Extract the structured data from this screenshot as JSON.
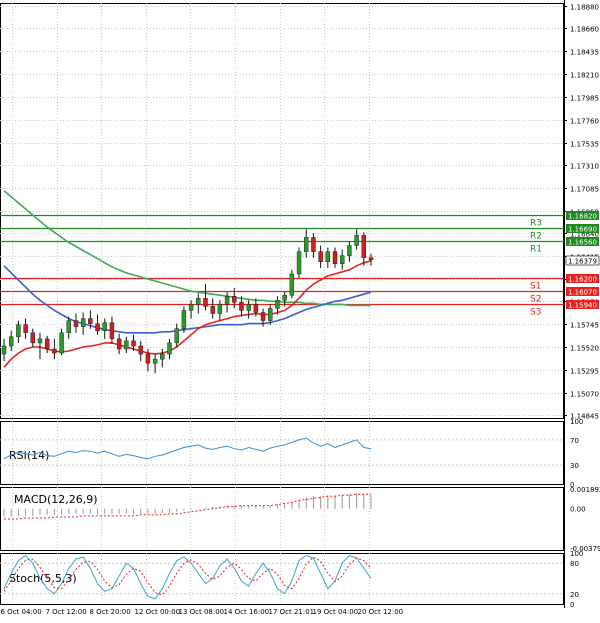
{
  "chart_data": {
    "type": "candlestick",
    "main_panel": {
      "y_ticks": [
        "1.18880",
        "1.18660",
        "1.18435",
        "1.18210",
        "1.17985",
        "1.17760",
        "1.17535",
        "1.17310",
        "1.17085",
        "1.16860",
        "1.16640",
        "1.16415",
        "1.16190",
        "1.15970",
        "1.15745",
        "1.15520",
        "1.15295",
        "1.15070",
        "1.14845"
      ],
      "ylim": [
        1.1482,
        1.1891
      ],
      "current_price": "1.16379",
      "levels": [
        {
          "label": "R3",
          "value": 1.1682,
          "value_label": "1.16820",
          "color": "#1f8a1f"
        },
        {
          "label": "R2",
          "value": 1.1669,
          "value_label": "1.16690",
          "color": "#1f8a1f"
        },
        {
          "label": "R1",
          "value": 1.1656,
          "value_label": "1.16560",
          "color": "#1f8a1f"
        },
        {
          "label": "S1",
          "value": 1.162,
          "value_label": "1.16200",
          "color": "#e52222"
        },
        {
          "label": "S2",
          "value": 1.1607,
          "value_label": "1.16070",
          "color": "#e52222"
        },
        {
          "label": "S3",
          "value": 1.1594,
          "value_label": "1.15940",
          "color": "#e52222"
        }
      ],
      "candles": [
        {
          "o": 1.1545,
          "h": 1.156,
          "l": 1.1538,
          "c": 1.1553
        },
        {
          "o": 1.1553,
          "h": 1.1568,
          "l": 1.1548,
          "c": 1.1562
        },
        {
          "o": 1.1562,
          "h": 1.1578,
          "l": 1.1556,
          "c": 1.1574
        },
        {
          "o": 1.1574,
          "h": 1.158,
          "l": 1.156,
          "c": 1.1566
        },
        {
          "o": 1.1566,
          "h": 1.157,
          "l": 1.1552,
          "c": 1.1556
        },
        {
          "o": 1.1556,
          "h": 1.1566,
          "l": 1.154,
          "c": 1.156
        },
        {
          "o": 1.156,
          "h": 1.1563,
          "l": 1.1546,
          "c": 1.155
        },
        {
          "o": 1.155,
          "h": 1.156,
          "l": 1.154,
          "c": 1.1546
        },
        {
          "o": 1.1546,
          "h": 1.157,
          "l": 1.1544,
          "c": 1.1566
        },
        {
          "o": 1.1566,
          "h": 1.1582,
          "l": 1.156,
          "c": 1.1578
        },
        {
          "o": 1.1578,
          "h": 1.1585,
          "l": 1.1566,
          "c": 1.1572
        },
        {
          "o": 1.1572,
          "h": 1.1586,
          "l": 1.1564,
          "c": 1.158
        },
        {
          "o": 1.158,
          "h": 1.1588,
          "l": 1.157,
          "c": 1.1575
        },
        {
          "o": 1.1575,
          "h": 1.1584,
          "l": 1.1564,
          "c": 1.1568
        },
        {
          "o": 1.1568,
          "h": 1.158,
          "l": 1.156,
          "c": 1.1576
        },
        {
          "o": 1.1576,
          "h": 1.1582,
          "l": 1.1555,
          "c": 1.156
        },
        {
          "o": 1.156,
          "h": 1.1565,
          "l": 1.1545,
          "c": 1.155
        },
        {
          "o": 1.155,
          "h": 1.1562,
          "l": 1.1546,
          "c": 1.1558
        },
        {
          "o": 1.1558,
          "h": 1.1564,
          "l": 1.1548,
          "c": 1.1553
        },
        {
          "o": 1.1553,
          "h": 1.1558,
          "l": 1.1538,
          "c": 1.1545
        },
        {
          "o": 1.1545,
          "h": 1.155,
          "l": 1.1528,
          "c": 1.1536
        },
        {
          "o": 1.1536,
          "h": 1.1545,
          "l": 1.1526,
          "c": 1.154
        },
        {
          "o": 1.154,
          "h": 1.155,
          "l": 1.1532,
          "c": 1.1545
        },
        {
          "o": 1.1545,
          "h": 1.156,
          "l": 1.154,
          "c": 1.1556
        },
        {
          "o": 1.1556,
          "h": 1.1575,
          "l": 1.1552,
          "c": 1.157
        },
        {
          "o": 1.157,
          "h": 1.1592,
          "l": 1.1566,
          "c": 1.1588
        },
        {
          "o": 1.1588,
          "h": 1.1598,
          "l": 1.158,
          "c": 1.1594
        },
        {
          "o": 1.1594,
          "h": 1.1605,
          "l": 1.1585,
          "c": 1.16
        },
        {
          "o": 1.16,
          "h": 1.1614,
          "l": 1.1588,
          "c": 1.1592
        },
        {
          "o": 1.1592,
          "h": 1.16,
          "l": 1.158,
          "c": 1.1585
        },
        {
          "o": 1.1585,
          "h": 1.1598,
          "l": 1.1578,
          "c": 1.1594
        },
        {
          "o": 1.1594,
          "h": 1.1606,
          "l": 1.1586,
          "c": 1.1602
        },
        {
          "o": 1.1602,
          "h": 1.161,
          "l": 1.159,
          "c": 1.1596
        },
        {
          "o": 1.1596,
          "h": 1.1602,
          "l": 1.1582,
          "c": 1.1588
        },
        {
          "o": 1.1588,
          "h": 1.1598,
          "l": 1.158,
          "c": 1.1594
        },
        {
          "o": 1.1594,
          "h": 1.16,
          "l": 1.1582,
          "c": 1.1586
        },
        {
          "o": 1.1586,
          "h": 1.159,
          "l": 1.1572,
          "c": 1.1578
        },
        {
          "o": 1.1578,
          "h": 1.1594,
          "l": 1.1574,
          "c": 1.159
        },
        {
          "o": 1.159,
          "h": 1.1602,
          "l": 1.1584,
          "c": 1.1598
        },
        {
          "o": 1.1598,
          "h": 1.1606,
          "l": 1.1592,
          "c": 1.1603
        },
        {
          "o": 1.1603,
          "h": 1.1628,
          "l": 1.16,
          "c": 1.1624
        },
        {
          "o": 1.1624,
          "h": 1.165,
          "l": 1.162,
          "c": 1.1646
        },
        {
          "o": 1.1646,
          "h": 1.1668,
          "l": 1.164,
          "c": 1.166
        },
        {
          "o": 1.166,
          "h": 1.1664,
          "l": 1.164,
          "c": 1.1646
        },
        {
          "o": 1.1646,
          "h": 1.1652,
          "l": 1.163,
          "c": 1.1636
        },
        {
          "o": 1.1636,
          "h": 1.165,
          "l": 1.163,
          "c": 1.1646
        },
        {
          "o": 1.1646,
          "h": 1.165,
          "l": 1.163,
          "c": 1.1634
        },
        {
          "o": 1.1634,
          "h": 1.1648,
          "l": 1.1628,
          "c": 1.1642
        },
        {
          "o": 1.1642,
          "h": 1.1656,
          "l": 1.1636,
          "c": 1.1652
        },
        {
          "o": 1.1652,
          "h": 1.1668,
          "l": 1.1648,
          "c": 1.1662
        },
        {
          "o": 1.1662,
          "h": 1.1665,
          "l": 1.1632,
          "c": 1.164
        },
        {
          "o": 1.164,
          "h": 1.1644,
          "l": 1.1632,
          "c": 1.1638
        }
      ],
      "ma_red": [
        1.1532,
        1.154,
        1.1546,
        1.155,
        1.1552,
        1.1552,
        1.155,
        1.1548,
        1.1547,
        1.1548,
        1.155,
        1.1552,
        1.1553,
        1.1554,
        1.1556,
        1.1556,
        1.1554,
        1.1552,
        1.155,
        1.1548,
        1.1546,
        1.1545,
        1.1546,
        1.1548,
        1.1552,
        1.1558,
        1.1564,
        1.157,
        1.1574,
        1.1576,
        1.1578,
        1.158,
        1.1582,
        1.1583,
        1.1584,
        1.1585,
        1.1584,
        1.1584,
        1.1586,
        1.1588,
        1.1593,
        1.16,
        1.1608,
        1.1614,
        1.1618,
        1.1622,
        1.1624,
        1.1626,
        1.1628,
        1.1632,
        1.1635,
        1.1637
      ],
      "ma_blue": [
        1.1632,
        1.1625,
        1.1618,
        1.1611,
        1.1604,
        1.1598,
        1.1593,
        1.1588,
        1.1584,
        1.158,
        1.1577,
        1.1575,
        1.1573,
        1.1571,
        1.1569,
        1.1568,
        1.1567,
        1.1566,
        1.1566,
        1.1566,
        1.1566,
        1.1566,
        1.1567,
        1.1567,
        1.1568,
        1.1569,
        1.157,
        1.1571,
        1.1572,
        1.1573,
        1.1574,
        1.1574,
        1.1574,
        1.1574,
        1.1575,
        1.1575,
        1.1575,
        1.1576,
        1.1578,
        1.158,
        1.1583,
        1.1586,
        1.1589,
        1.1591,
        1.1593,
        1.1595,
        1.1597,
        1.1598,
        1.16,
        1.1602,
        1.1604,
        1.1606
      ],
      "ma_green": [
        1.1706,
        1.17,
        1.1694,
        1.1688,
        1.1682,
        1.1676,
        1.167,
        1.1665,
        1.166,
        1.1655,
        1.1651,
        1.1647,
        1.1643,
        1.1639,
        1.1635,
        1.1631,
        1.1628,
        1.1625,
        1.1623,
        1.1621,
        1.1619,
        1.1617,
        1.1615,
        1.1613,
        1.1611,
        1.1609,
        1.1607,
        1.1606,
        1.1605,
        1.1604,
        1.1603,
        1.1602,
        1.1601,
        1.16,
        1.1599,
        1.1598,
        1.1598,
        1.1597,
        1.1597,
        1.1596,
        1.1596,
        1.1596,
        1.1595,
        1.1595,
        1.1594,
        1.1594,
        1.1594,
        1.1594,
        1.1593,
        1.1593,
        1.1593,
        1.1593
      ]
    },
    "rsi_panel": {
      "label": "RSI(14)",
      "y_ticks": [
        "100",
        "70",
        "30",
        "0"
      ],
      "ylim": [
        0,
        100
      ],
      "values": [
        40,
        46,
        50,
        48,
        46,
        50,
        45,
        44,
        48,
        52,
        50,
        53,
        52,
        49,
        52,
        48,
        44,
        47,
        45,
        42,
        40,
        44,
        46,
        50,
        54,
        58,
        60,
        62,
        57,
        55,
        58,
        60,
        56,
        54,
        58,
        55,
        52,
        57,
        60,
        62,
        66,
        70,
        73,
        65,
        60,
        64,
        58,
        62,
        66,
        70,
        58,
        56
      ]
    },
    "macd_panel": {
      "label": "MACD(12,26,9)",
      "y_ticks": [
        "0.001892",
        "0.00",
        "-0.003794"
      ],
      "ylim": [
        -0.004,
        0.0021
      ],
      "histogram": [
        -0.0008,
        -0.0008,
        -0.0007,
        -0.0007,
        -0.0007,
        -0.0006,
        -0.0006,
        -0.0006,
        -0.0006,
        -0.0005,
        -0.0005,
        -0.0005,
        -0.0005,
        -0.0005,
        -0.0005,
        -0.0005,
        -0.0005,
        -0.0005,
        -0.0005,
        -0.0005,
        -0.0005,
        -0.0005,
        -0.0004,
        -0.0004,
        -0.0003,
        -0.0002,
        -0.0001,
        0.0,
        0.0001,
        0.0002,
        0.0002,
        0.0003,
        0.0003,
        0.0003,
        0.0003,
        0.0003,
        0.0003,
        0.0003,
        0.0004,
        0.0005,
        0.0007,
        0.0009,
        0.0011,
        0.0012,
        0.0012,
        0.0013,
        0.0013,
        0.0013,
        0.0014,
        0.0015,
        0.0014,
        0.0014
      ],
      "signal": [
        -0.001,
        -0.001,
        -0.001,
        -0.0009,
        -0.0009,
        -0.0009,
        -0.0009,
        -0.0008,
        -0.0008,
        -0.0008,
        -0.0008,
        -0.0007,
        -0.0007,
        -0.0007,
        -0.0007,
        -0.0007,
        -0.0007,
        -0.0007,
        -0.0007,
        -0.0006,
        -0.0006,
        -0.0006,
        -0.0006,
        -0.0005,
        -0.0005,
        -0.0004,
        -0.0003,
        -0.0002,
        -0.0001,
        0.0,
        0.0001,
        0.0002,
        0.0002,
        0.0003,
        0.0003,
        0.0003,
        0.0003,
        0.0003,
        0.0004,
        0.0005,
        0.0006,
        0.0008,
        0.0009,
        0.001,
        0.0011,
        0.0012,
        0.0012,
        0.0013,
        0.0013,
        0.0014,
        0.0014,
        0.0014
      ]
    },
    "stoch_panel": {
      "label": "Stoch(5,5,3)",
      "y_ticks": [
        "100",
        "80",
        "20",
        "0"
      ],
      "ylim": [
        0,
        100
      ],
      "k": [
        30,
        60,
        85,
        95,
        80,
        50,
        30,
        20,
        40,
        70,
        88,
        92,
        70,
        40,
        25,
        30,
        55,
        80,
        70,
        40,
        15,
        10,
        30,
        60,
        85,
        92,
        80,
        60,
        40,
        50,
        75,
        88,
        70,
        45,
        35,
        60,
        80,
        60,
        30,
        20,
        45,
        85,
        95,
        90,
        60,
        30,
        45,
        80,
        95,
        90,
        70,
        50
      ],
      "d": [
        25,
        45,
        70,
        86,
        88,
        72,
        50,
        32,
        30,
        48,
        68,
        82,
        84,
        68,
        45,
        32,
        38,
        58,
        70,
        64,
        42,
        22,
        18,
        35,
        60,
        80,
        86,
        78,
        60,
        48,
        55,
        72,
        80,
        68,
        50,
        45,
        60,
        70,
        58,
        36,
        30,
        50,
        78,
        92,
        84,
        60,
        44,
        55,
        78,
        90,
        85,
        70
      ]
    },
    "x_ticks": [
      "6 Oct 04:00",
      "7 Oct 12:00",
      "8 Oct 20:00",
      "12 Oct 00:00",
      "13 Oct 08:00",
      "14 Oct 16:00",
      "17 Oct 21:01",
      "19 Oct 04:00",
      "20 Oct 12:00"
    ]
  }
}
